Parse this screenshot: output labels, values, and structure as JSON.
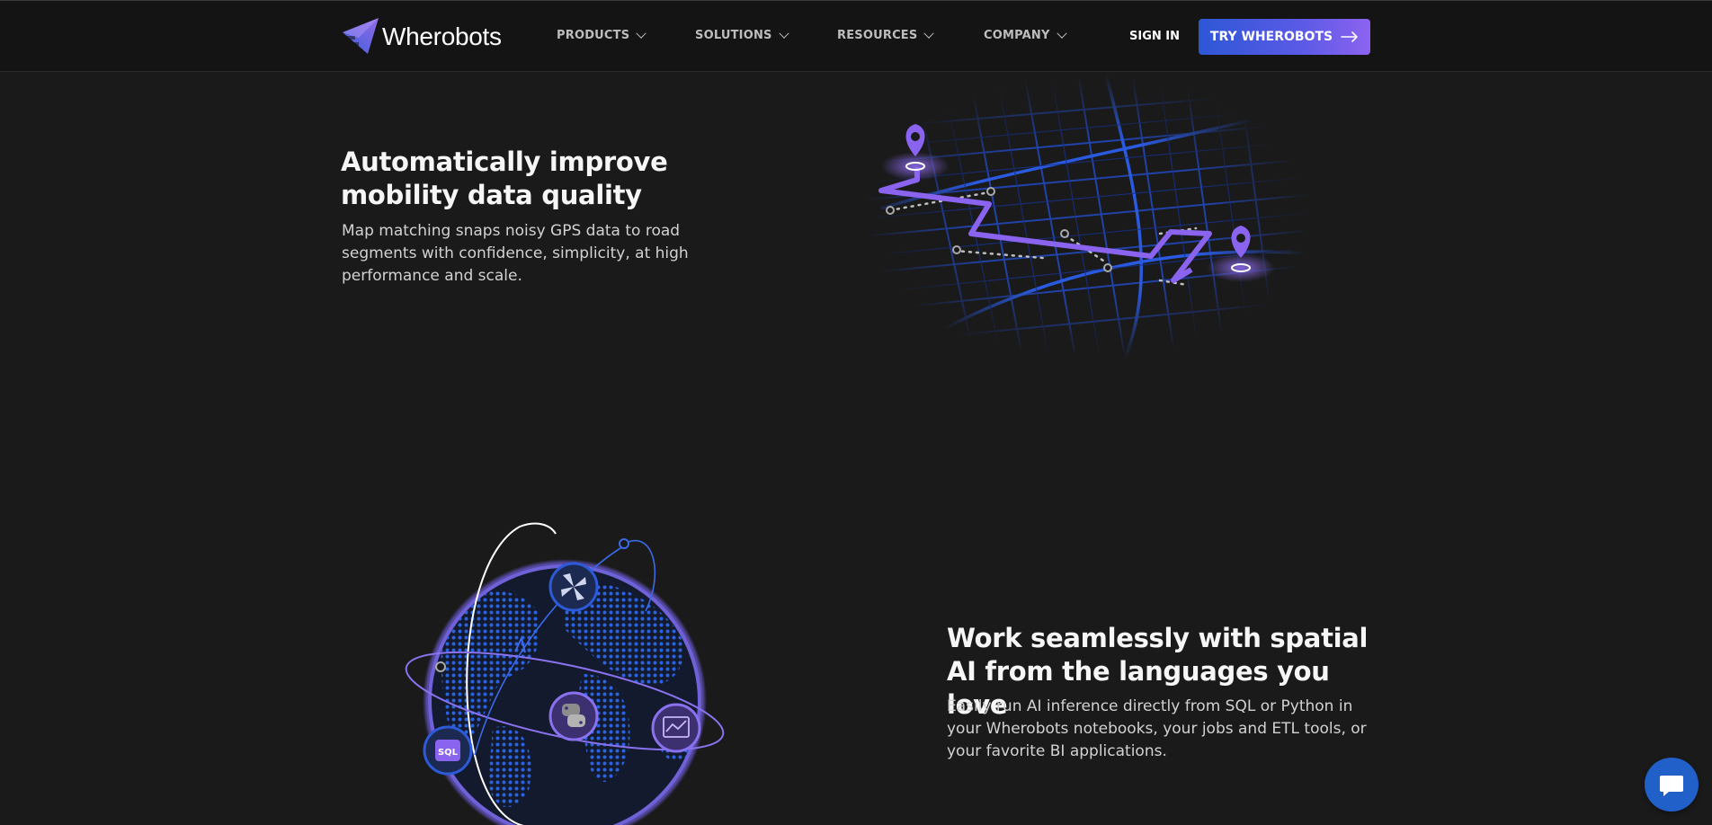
{
  "brand": {
    "name": "Wherobots",
    "accent": "#5b5ae6",
    "cta_gradient": [
      "#2d57d6",
      "#8c63f0"
    ]
  },
  "nav": {
    "items": [
      {
        "label": "PRODUCTS"
      },
      {
        "label": "SOLUTIONS"
      },
      {
        "label": "RESOURCES"
      },
      {
        "label": "COMPANY"
      }
    ],
    "sign_in": "SIGN IN",
    "cta": "TRY WHEROBOTS"
  },
  "section1": {
    "title": "Automatically improve mobility data quality",
    "description": "Map matching snaps noisy GPS data to road segments with confidence, simplicity, at high performance and scale.",
    "illustration_icon": "map-route-icon"
  },
  "section2": {
    "title": "Work seamlessly with spatial AI from the languages you love",
    "description": "Easily run AI inference directly from SQL or Python in your Wherobots notebooks, your jobs and ETL tools, or your favorite BI applications.",
    "illustration_icon": "globe-integrations-icon",
    "badges": {
      "sql": "SQL"
    }
  },
  "chat": {
    "icon": "chat-bubble-icon",
    "color": "#2160c9"
  }
}
